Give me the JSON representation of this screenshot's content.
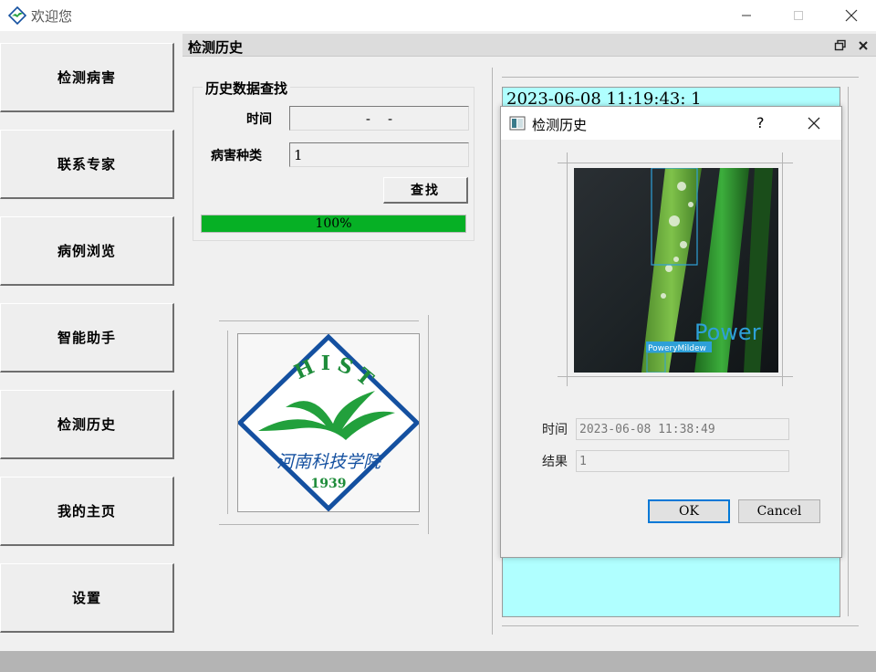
{
  "window": {
    "title": "欢迎您"
  },
  "nav": {
    "items": [
      {
        "label": "检测病害"
      },
      {
        "label": "联系专家"
      },
      {
        "label": "病例浏览"
      },
      {
        "label": "智能助手"
      },
      {
        "label": "检测历史"
      },
      {
        "label": "我的主页"
      },
      {
        "label": "设置"
      }
    ]
  },
  "subwindow": {
    "title": "检测历史",
    "search": {
      "group_title": "历史数据查找",
      "time_label": "时间",
      "time_value": "-    -",
      "disease_label": "病害种类",
      "disease_value": "1",
      "search_button": "查找",
      "progress": 100,
      "progress_text": "100%"
    },
    "logo": {
      "text_top": "HIST",
      "text_name": "河南科技学院",
      "text_year": "1939"
    },
    "history_list": [
      "2023-06-08 11:19:43: 1"
    ]
  },
  "dialog": {
    "title": "检测历史",
    "help_glyph": "?",
    "detection_label": "PoweryMildew",
    "overlay_text": "Power",
    "time_label": "时间",
    "time_value": "2023-06-08 11:38:49",
    "result_label": "结果",
    "result_value": "1",
    "ok_label": "OK",
    "cancel_label": "Cancel"
  },
  "colors": {
    "accent_green": "#06b025",
    "list_bg": "#b0ffff",
    "logo_blue": "#1450a0",
    "logo_green": "#22a03c"
  }
}
